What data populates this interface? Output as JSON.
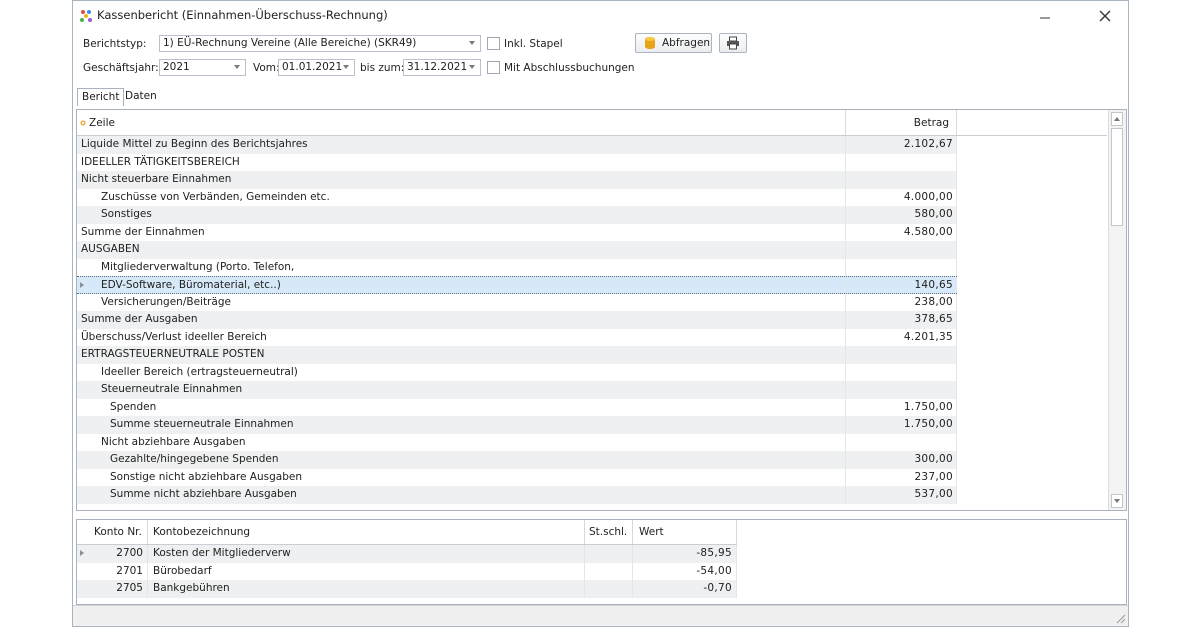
{
  "window": {
    "title": "Kassenbericht (Einnahmen-Überschuss-Rechnung)"
  },
  "filters": {
    "berichtstyp_label": "Berichtstyp:",
    "berichtstyp_value": "1) EÜ-Rechnung Vereine (Alle Bereiche) (SKR49)",
    "inkl_stapel_label": "Inkl. Stapel",
    "inkl_stapel_checked": false,
    "abfragen_label": "Abfragen",
    "geschaeftsjahr_label": "Geschäftsjahr:",
    "geschaeftsjahr_value": "2021",
    "vom_label": "Vom:",
    "vom_value": "01.01.2021",
    "bis_label": "bis zum:",
    "bis_value": "31.12.2021",
    "abschluss_label": "Mit Abschlussbuchungen",
    "abschluss_checked": false
  },
  "tabs": [
    {
      "label": "Bericht",
      "active": true
    },
    {
      "label": "Daten",
      "active": false
    }
  ],
  "report": {
    "col_zeile": "Zeile",
    "col_betrag": "Betrag",
    "rows": [
      {
        "label": "Liquide Mittel zu Beginn des Berichtsjahres",
        "value": "2.102,67",
        "indent": 0
      },
      {
        "label": "IDEELLER TÄTIGKEITSBEREICH",
        "value": "",
        "indent": 0
      },
      {
        "label": "Nicht steuerbare Einnahmen",
        "value": "",
        "indent": 0
      },
      {
        "label": "Zuschüsse von Verbänden, Gemeinden etc.",
        "value": "4.000,00",
        "indent": 1
      },
      {
        "label": "Sonstiges",
        "value": "580,00",
        "indent": 1
      },
      {
        "label": "Summe der Einnahmen",
        "value": "4.580,00",
        "indent": 0
      },
      {
        "label": "AUSGABEN",
        "value": "",
        "indent": 0
      },
      {
        "label": "Mitgliederverwaltung (Porto. Telefon,",
        "value": "",
        "indent": 1
      },
      {
        "label": "EDV-Software, Büromaterial, etc..)",
        "value": "140,65",
        "indent": 1
      },
      {
        "label": "Versicherungen/Beiträge",
        "value": "238,00",
        "indent": 1
      },
      {
        "label": "Summe der Ausgaben",
        "value": "378,65",
        "indent": 0
      },
      {
        "label": "Überschuss/Verlust ideeller Bereich",
        "value": "4.201,35",
        "indent": 0
      },
      {
        "label": "ERTRAGSTEUERNEUTRALE POSTEN",
        "value": "",
        "indent": 0
      },
      {
        "label": "Ideeller Bereich (ertragsteuerneutral)",
        "value": "",
        "indent": 1
      },
      {
        "label": "Steuerneutrale Einnahmen",
        "value": "",
        "indent": 1
      },
      {
        "label": "Spenden",
        "value": "1.750,00",
        "indent": 2
      },
      {
        "label": "Summe steuerneutrale Einnahmen",
        "value": "1.750,00",
        "indent": 2
      },
      {
        "label": "Nicht abziehbare Ausgaben",
        "value": "",
        "indent": 1
      },
      {
        "label": "Gezahlte/hingegebene Spenden",
        "value": "300,00",
        "indent": 2
      },
      {
        "label": "Sonstige nicht abziehbare Ausgaben",
        "value": "237,00",
        "indent": 2
      },
      {
        "label": "Summe nicht abziehbare Ausgaben",
        "value": "537,00",
        "indent": 2
      }
    ]
  },
  "detail": {
    "col_konto": "Konto Nr.",
    "col_bezeichnung": "Kontobezeichnung",
    "col_stschl": "St.schl.",
    "col_wert": "Wert",
    "rows": [
      {
        "konto": "2700",
        "bezeichnung": "Kosten der Mitgliederverw",
        "stschl": "",
        "wert": "-85,95"
      },
      {
        "konto": "2701",
        "bezeichnung": "Bürobedarf",
        "stschl": "",
        "wert": "-54,00"
      },
      {
        "konto": "2705",
        "bezeichnung": "Bankgebühren",
        "stschl": "",
        "wert": "-0,70"
      }
    ]
  },
  "colors": {
    "selected_row": "#d7e9f8",
    "alt_row": "#eff0f1",
    "border": "#aab3bd",
    "db_icon": "#e8a317"
  }
}
